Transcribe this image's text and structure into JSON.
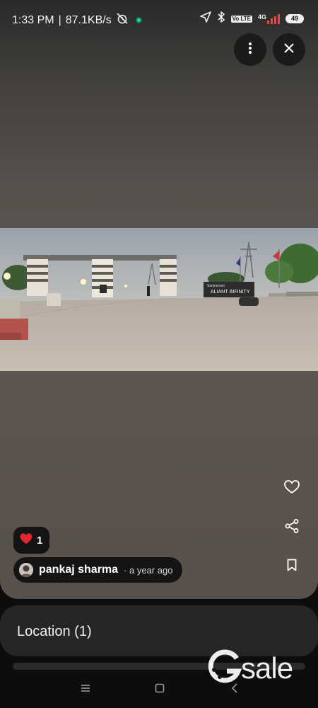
{
  "status_bar": {
    "time": "1:33 PM",
    "separator": "|",
    "speed": "87.1KB/s",
    "network_badge": "Vo LTE",
    "network_type": "4G",
    "battery": "49"
  },
  "viewer": {
    "more_icon": "more-vertical-icon",
    "close_icon": "close-icon"
  },
  "photo": {
    "sign_small": "Sanjeevani",
    "sign_large": "ALIANT INFINITY"
  },
  "side_actions": {
    "like_icon": "heart-outline-icon",
    "share_icon": "share-icon",
    "save_icon": "bookmark-icon"
  },
  "reaction": {
    "icon": "heart-filled-icon",
    "count": "1"
  },
  "author": {
    "name": "pankaj sharma",
    "time": "· a year ago"
  },
  "location_panel": {
    "title": "Location (1)"
  },
  "watermark": {
    "text": "sale"
  },
  "colors": {
    "heart_red": "#e6262e",
    "status_green": "#28d89a",
    "signal_red": "#e54848"
  }
}
